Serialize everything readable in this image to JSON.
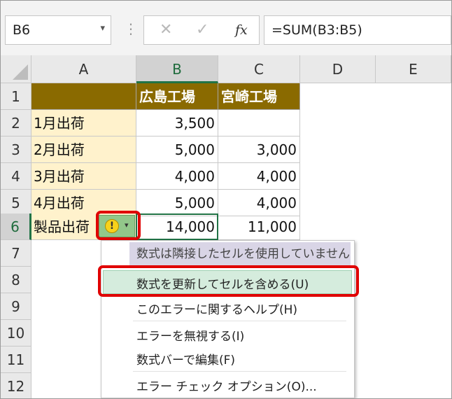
{
  "formula_bar": {
    "name_box": "B6",
    "name_box_arrow": "▾",
    "separator": "⋮",
    "cancel_icon": "✕",
    "enter_icon": "✓",
    "fx_label": "fx",
    "formula": "=SUM(B3:B5)"
  },
  "columns": [
    "A",
    "B",
    "C",
    "D",
    "E"
  ],
  "rows": [
    "1",
    "2",
    "3",
    "4",
    "5",
    "6",
    "7",
    "8",
    "9",
    "10",
    "11",
    "12"
  ],
  "sheet": {
    "B1": "広島工場",
    "C1": "宮崎工場",
    "A2": "1月出荷",
    "B2": "3,500",
    "A3": "2月出荷",
    "B3": "5,000",
    "C3": "3,000",
    "A4": "3月出荷",
    "B4": "4,000",
    "C4": "4,000",
    "A5": "4月出荷",
    "B5": "5,000",
    "C5": "4,000",
    "A6": "製品出荷",
    "B6": "14,000",
    "C6": "11,000"
  },
  "smart_tag": {
    "warning_symbol": "!",
    "dropdown_arrow": "▾"
  },
  "error_menu": {
    "header": "数式は隣接したセルを使用していません",
    "items": [
      "数式を更新してセルを含める(U)",
      "このエラーに関するヘルプ(H)",
      "エラーを無視する(I)",
      "数式バーで編集(F)",
      "エラー チェック オプション(O)..."
    ]
  },
  "colors": {
    "header_fill": "#8a6a00",
    "label_fill": "#fff2cc",
    "selection_green": "#217346",
    "highlight_red": "#e00000",
    "menu_highlight": "#d5ecdd"
  }
}
